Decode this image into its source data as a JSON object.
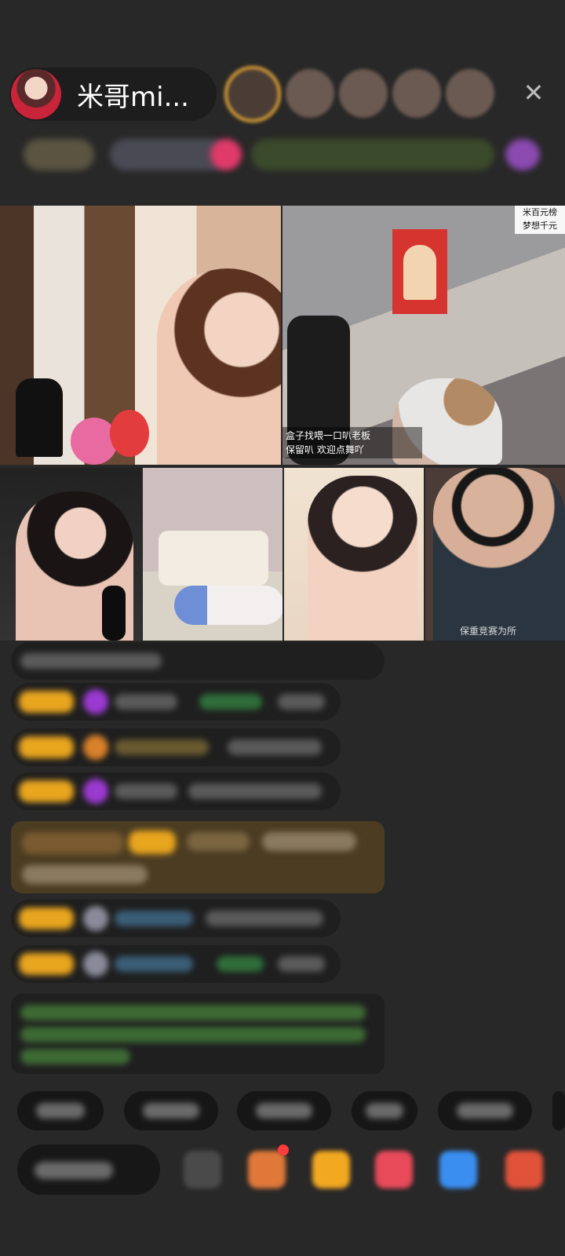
{
  "host": {
    "name": "米哥mi..."
  },
  "header": {
    "close_glyph": "✕"
  },
  "tiles": {
    "tile2_badge": "米百元榜\n梦想千元",
    "tile2_caption": "盒子找喂一口叭老板\n保留叭   欢迎点舞吖",
    "tile6_caption": "保重竞赛为所"
  },
  "colors": {
    "background": "#282828",
    "gold_badge": "#e8a51e",
    "banner": "#4b3c22"
  },
  "icons": {
    "close": "close-icon",
    "gift": "gift-icon",
    "more": "more-icon"
  }
}
